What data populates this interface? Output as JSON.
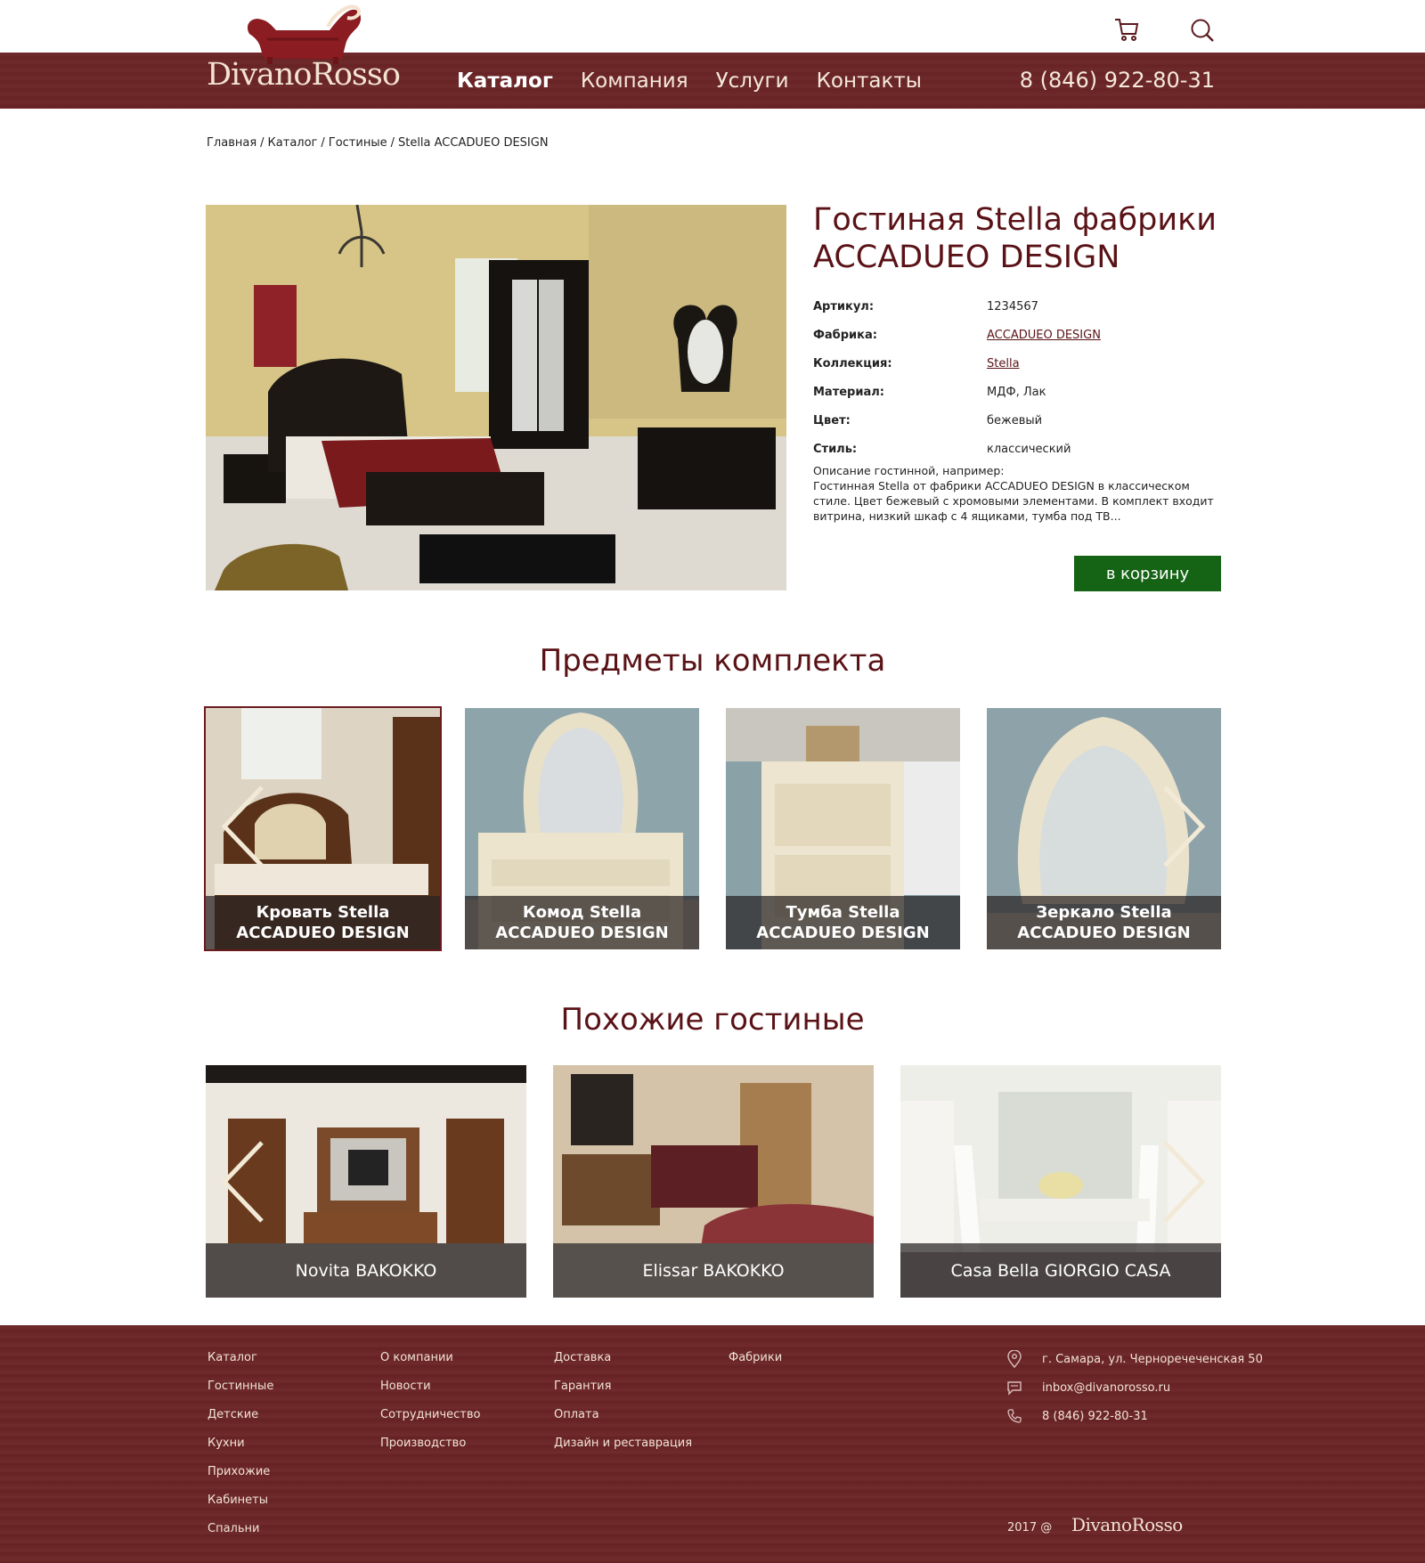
{
  "header": {
    "logo_text": "DivanoRosso",
    "nav": [
      {
        "label": "Каталог"
      },
      {
        "label": "Компания"
      },
      {
        "label": "Услуги"
      },
      {
        "label": "Контакты"
      }
    ],
    "phone": "8 (846) 922-80-31",
    "icons": [
      "cart-icon",
      "search-icon"
    ]
  },
  "breadcrumb": [
    "Главная",
    "Каталог",
    "Гостиные",
    "Stella ACCADUEO DESIGN"
  ],
  "breadcrumb_sep": "/",
  "product": {
    "title": "Гостиная Stella фабрики ACCADUEO DESIGN",
    "specs": [
      {
        "key": "Артикул:",
        "value": "1234567"
      },
      {
        "key": "Фабрика:",
        "value": "ACCADUEO DESIGN"
      },
      {
        "key": "Коллекция:",
        "value": "Stella"
      },
      {
        "key": "Материал:",
        "value": "МДФ, Лак"
      },
      {
        "key": "Цвет:",
        "value": "бежевый"
      },
      {
        "key": "Стиль:",
        "value": "классический"
      }
    ],
    "description_intro": "Описание гостинной, например:",
    "description": "Гостинная Stella от фабрики ACCADUEO DESIGN в классическом стиле. Цвет бежевый с хромовыми элементами. В комплект входит витрина, низкий шкаф с 4 ящиками, тумба под ТВ...",
    "cart_button": "в корзину"
  },
  "set_section": {
    "title": "Предметы комплекта",
    "items": [
      {
        "label": "Кровать Stella ACCADUEO DESIGN"
      },
      {
        "label": "Комод Stella ACCADUEO DESIGN"
      },
      {
        "label": "Тумба Stella ACCADUEO DESIGN"
      },
      {
        "label": "Зеркало Stella ACCADUEO DESIGN"
      }
    ]
  },
  "similar_section": {
    "title": "Похожие гостиные",
    "items": [
      {
        "label": "Novita BAKOKKO"
      },
      {
        "label": "Elissar BAKOKKO"
      },
      {
        "label": "Casa Bella GIORGIO CASA"
      }
    ]
  },
  "footer": {
    "col1": [
      "Каталог",
      "Гостинные",
      "Детские",
      "Кухни",
      "Прихожие",
      "Кабинеты",
      "Спальни"
    ],
    "col2": [
      "О компании",
      "Новости",
      "Сотрудничество",
      "Производство"
    ],
    "col3": [
      "Доставка",
      "Гарантия",
      "Оплата",
      "Дизайн и реставрация"
    ],
    "col4": [
      "Фабрики"
    ],
    "contacts": {
      "address": "г. Самара, ул. Черноречеченская 50",
      "email": "inbox@divanorosso.ru",
      "phone": "8 (846) 922-80-31"
    },
    "copyright": "2017 @",
    "logo_text": "DivanoRosso"
  },
  "colors": {
    "brand_burgundy": "#6b2627",
    "title": "#5a1216",
    "cart_button": "#156314"
  }
}
